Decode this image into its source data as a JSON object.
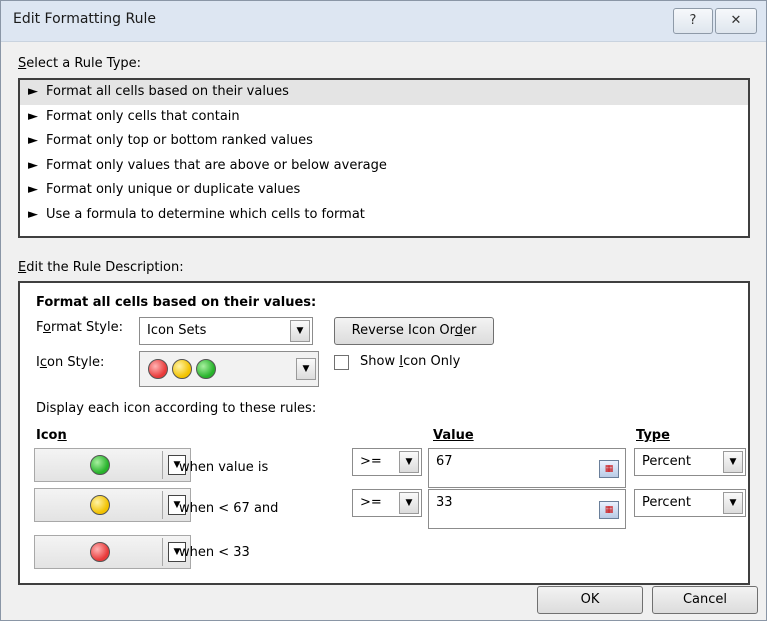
{
  "dialog": {
    "title": "Edit Formatting Rule",
    "help_glyph": "?",
    "close_glyph": "✕"
  },
  "rule_type": {
    "label_first": "S",
    "label_rest": "elect a Rule Type:",
    "arrow_glyph": "►",
    "items": [
      "Format all cells based on their values",
      "Format only cells that contain",
      "Format only top or bottom ranked values",
      "Format only values that are above or below average",
      "Format only unique or duplicate values",
      "Use a formula to determine which cells to format"
    ]
  },
  "description": {
    "label_first": "E",
    "label_rest": "dit the Rule Description:",
    "heading": "Format all cells based on their values:",
    "format_style_label_a": "F",
    "format_style_label_u": "o",
    "format_style_label_b": "rmat Style:",
    "format_style_value": "Icon Sets",
    "reverse_button_a": "Reverse Icon Or",
    "reverse_button_u": "d",
    "reverse_button_b": "er",
    "icon_style_label_a": "I",
    "icon_style_label_u": "c",
    "icon_style_label_b": "on Style:",
    "show_icon_only_a": "Show ",
    "show_icon_only_u": "I",
    "show_icon_only_b": "con Only",
    "show_icon_only_checked": false,
    "display_rules_label": "Display each icon according to these rules:",
    "col_icon_a": "Ico",
    "col_icon_u": "n",
    "col_value": "Value",
    "col_type": "Type",
    "combo_arrow_glyph": "▼",
    "rules": [
      {
        "icon": "green-circle",
        "condition": "when value is",
        "operator": ">=",
        "value": "67",
        "type": "Percent"
      },
      {
        "icon": "yellow-circle",
        "condition": "when < 67 and",
        "operator": ">=",
        "value": "33",
        "type": "Percent"
      },
      {
        "icon": "red-circle",
        "condition": "when < 33"
      }
    ]
  },
  "footer": {
    "ok_label": "OK",
    "cancel_label": "Cancel"
  },
  "colors": {
    "red": "#e83a3a",
    "yellow": "#f2c200",
    "green": "#27b32b",
    "titlebar": "#dde6f2"
  }
}
